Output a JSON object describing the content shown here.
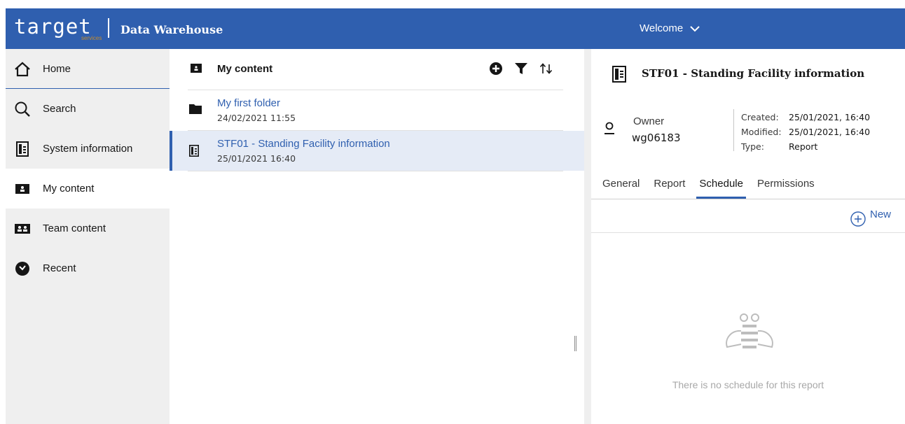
{
  "header": {
    "logo_text": "target",
    "logo_sub": "services",
    "app_title": "Data Warehouse",
    "welcome_label": "Welcome",
    "brand_color": "#2f5faf"
  },
  "sidebar": {
    "items": [
      {
        "label": "Home",
        "icon": "home-icon"
      },
      {
        "label": "Search",
        "icon": "search-icon"
      },
      {
        "label": "System information",
        "icon": "report-icon"
      },
      {
        "label": "My content",
        "icon": "my-content-icon",
        "active": true
      },
      {
        "label": "Team content",
        "icon": "team-content-icon"
      },
      {
        "label": "Recent",
        "icon": "recent-clock-icon"
      }
    ]
  },
  "content": {
    "title": "My content",
    "tools": [
      "add-icon",
      "filter-icon",
      "sort-icon"
    ],
    "rows": [
      {
        "name": "My first folder",
        "date": "24/02/2021 11:55",
        "icon": "folder-icon"
      },
      {
        "name": "STF01 - Standing Facility information",
        "date": "25/01/2021 16:40",
        "icon": "report-icon",
        "selected": true
      }
    ]
  },
  "details": {
    "title": "STF01 - Standing Facility information",
    "owner_label": "Owner",
    "owner_value": "wg06183",
    "created_label": "Created:",
    "created_value": "25/01/2021, 16:40",
    "modified_label": "Modified:",
    "modified_value": "25/01/2021, 16:40",
    "type_label": "Type:",
    "type_value": "Report",
    "tabs": [
      {
        "label": "General"
      },
      {
        "label": "Report"
      },
      {
        "label": "Schedule",
        "active": true
      },
      {
        "label": "Permissions"
      }
    ],
    "new_label": "New",
    "empty_message": "There is no schedule for this report"
  }
}
